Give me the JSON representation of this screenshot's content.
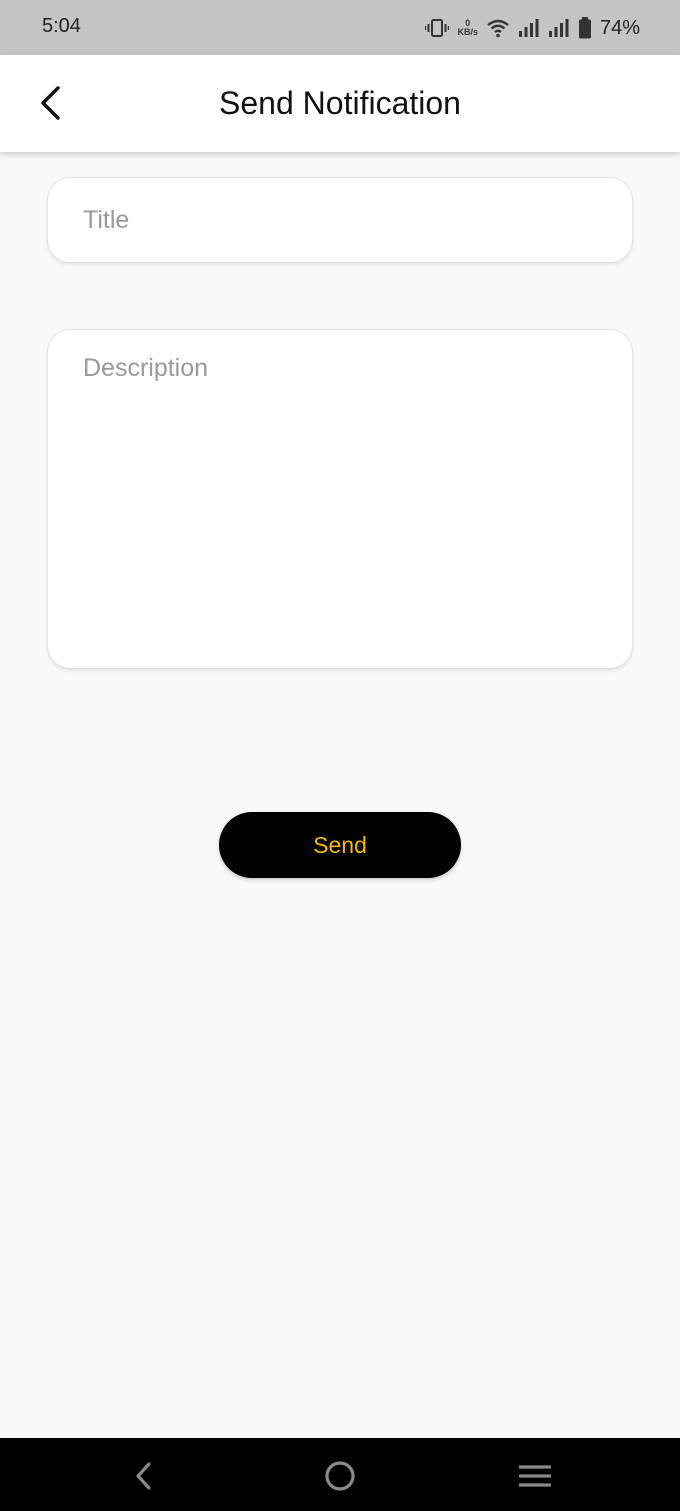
{
  "status_bar": {
    "time": "5:04",
    "net_speed_value": "0",
    "net_speed_unit": "KB/s",
    "battery_percent": "74%",
    "icons": [
      "vibrate-icon",
      "wifi-icon",
      "signal-icon",
      "signal-icon",
      "battery-icon"
    ]
  },
  "app_bar": {
    "title": "Send Notification",
    "back_icon": "back-arrow-icon"
  },
  "form": {
    "title_placeholder": "Title",
    "title_value": "",
    "description_placeholder": "Description",
    "description_value": "",
    "send_label": "Send"
  },
  "colors": {
    "send_text": "#f5b800",
    "send_bg": "#000000",
    "background": "#f9f9f9"
  },
  "nav_bar": {
    "icons": [
      "nav-back-icon",
      "nav-home-icon",
      "nav-menu-icon"
    ]
  }
}
